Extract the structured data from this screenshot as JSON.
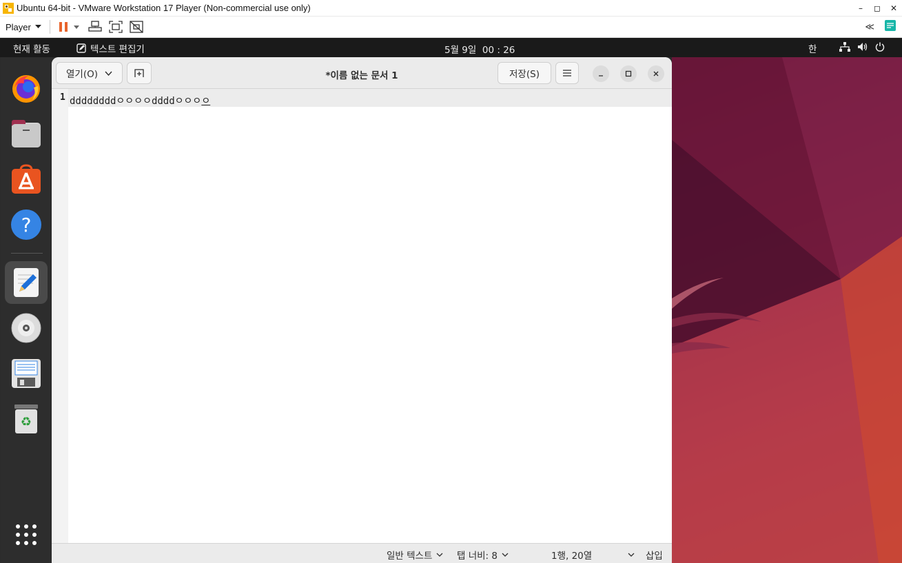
{
  "host_window": {
    "title": "Ubuntu 64-bit - VMware Workstation 17 Player (Non-commercial use only)",
    "controls": {
      "minimize": "–",
      "maximize": "◻",
      "close": "✕"
    }
  },
  "host_toolbar": {
    "player_menu": "Player",
    "icons": [
      "pause-icon",
      "dropdown-icon",
      "send-ctrl-alt-del-icon",
      "fullscreen-icon",
      "unity-icon",
      "collapse-icon",
      "notes-icon"
    ],
    "collapse_label": "≪"
  },
  "top_bar": {
    "activities": "현재 활동",
    "app_name": "텍스트 편집기",
    "clock": "5월 9일  00 : 26",
    "input_method": "한",
    "status_icons": [
      "network-icon",
      "volume-icon",
      "power-icon"
    ]
  },
  "dock": {
    "items": [
      "firefox-icon",
      "files-icon",
      "app-center-icon",
      "help-icon",
      "text-editor-icon",
      "disc-icon",
      "floppy-icon",
      "trash-icon",
      "show-apps-icon"
    ],
    "active": "text-editor-icon"
  },
  "gedit": {
    "open_label": "열기(O)",
    "title": "*이름 없는 문서 1",
    "save_label": "저장(S)",
    "lines": [
      {
        "number": "1",
        "text": "ddddddddㅇㅇㅇㅇddddㅇㅇㅇ",
        "preedit": "ㅇ"
      }
    ],
    "status": {
      "language": "일반 텍스트",
      "tab_width": "탭 너비: 8",
      "position": "1행, 20열",
      "mode": "삽입"
    }
  },
  "colors": {
    "accent": "#e95420",
    "panel": "#1a1a1a",
    "dock": "#2d2d2d",
    "headerbar": "#ebebeb"
  }
}
